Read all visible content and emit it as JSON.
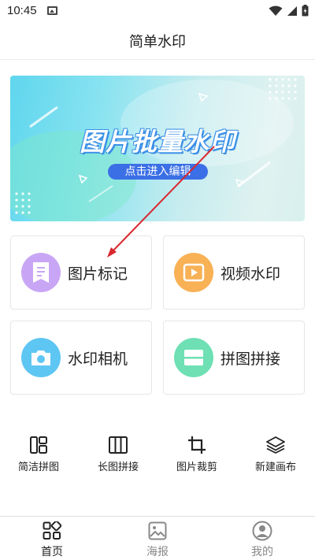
{
  "status_bar": {
    "time": "10:45"
  },
  "header": {
    "title": "简单水印"
  },
  "banner": {
    "title": "图片批量水印",
    "button_label": "点击进入编辑"
  },
  "features": [
    {
      "label": "图片标记",
      "icon": "document-icon",
      "color": "#c9a6f5"
    },
    {
      "label": "视频水印",
      "icon": "play-icon",
      "color": "#f8b155"
    },
    {
      "label": "水印相机",
      "icon": "camera-icon",
      "color": "#5ec6f3"
    },
    {
      "label": "拼图拼接",
      "icon": "collage-icon",
      "color": "#6ee0b4"
    }
  ],
  "tools": [
    {
      "label": "简洁拼图",
      "icon": "grid-layout-icon"
    },
    {
      "label": "长图拼接",
      "icon": "columns-icon"
    },
    {
      "label": "图片裁剪",
      "icon": "crop-icon"
    },
    {
      "label": "新建画布",
      "icon": "layers-icon"
    }
  ],
  "bottom_nav": [
    {
      "label": "首页",
      "icon": "home-grid-icon",
      "active": true
    },
    {
      "label": "海报",
      "icon": "image-icon",
      "active": false
    },
    {
      "label": "我的",
      "icon": "profile-icon",
      "active": false
    }
  ],
  "colors": {
    "accent_arrow": "#d9282f",
    "banner_button": "#3b6fe6"
  }
}
